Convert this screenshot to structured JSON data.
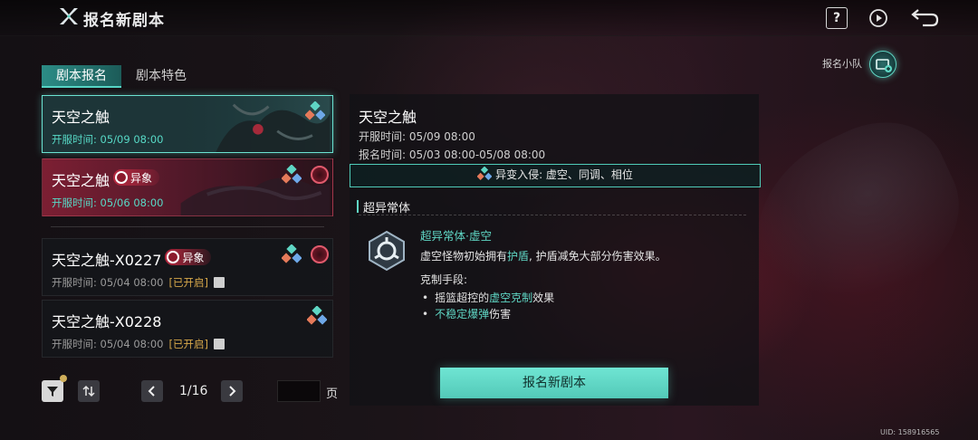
{
  "header": {
    "title": "报名新剧本",
    "help_label": "?"
  },
  "squad": {
    "label": "报名小队"
  },
  "tabs": [
    {
      "label": "剧本报名",
      "active": true
    },
    {
      "label": "剧本特色",
      "active": false
    }
  ],
  "cards": [
    {
      "name": "天空之触",
      "badge": "",
      "time": "开服时间: 05/09 08:00",
      "status": "",
      "selected": true
    },
    {
      "name": "天空之触",
      "badge": "异象",
      "time": "开服时间: 05/06 08:00",
      "status": "",
      "selected": false
    },
    {
      "name": "天空之触-X0227",
      "badge": "异象",
      "time": "开服时间: 05/04 08:00",
      "status": "[已开启]",
      "selected": false
    },
    {
      "name": "天空之触-X0228",
      "badge": "",
      "time": "开服时间: 05/04 08:00",
      "status": "[已开启]",
      "selected": false
    }
  ],
  "pager": {
    "current": "1/16",
    "unit": "页",
    "input_value": ""
  },
  "detail": {
    "title": "天空之触",
    "open_time": "开服时间: 05/09 08:00",
    "signup_time": "报名时间: 05/03 08:00-05/08 08:00",
    "invasion": "异变入侵: 虚空、同调、相位",
    "section_title": "超异常体",
    "ability_name": "超异常体·虚空",
    "ability_desc_pre": "虚空怪物初始拥有",
    "ability_desc_hl": "护盾",
    "ability_desc_post": ", 护盾减免大部分伤害效果。",
    "counter_title": "克制手段:",
    "counter1_pre": "摇篮超控的",
    "counter1_hl": "虚空克制",
    "counter1_post": "效果",
    "counter2_hl": "不稳定爆弹",
    "counter2_post": "伤害"
  },
  "signup_button": "报名新剧本",
  "uid": "UID: 158916565",
  "colors": {
    "accent": "#5fd6c4",
    "anomaly": "#b8283f",
    "status_open": "#d7a84a"
  }
}
